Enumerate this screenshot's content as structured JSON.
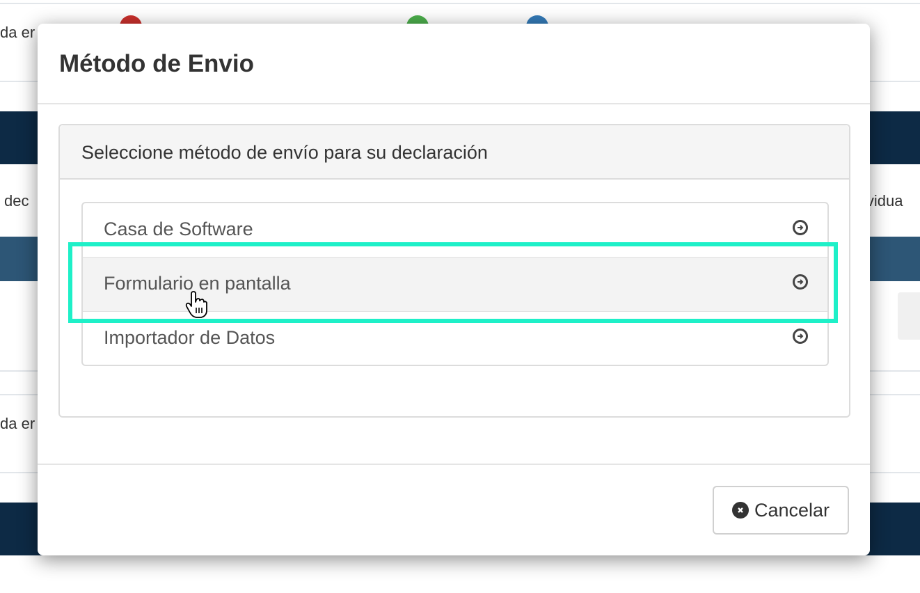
{
  "background": {
    "fragments": {
      "top_left": "da er",
      "mid_left": "dec",
      "mid_right": "ividua",
      "lower_left": "da er"
    },
    "legend_colors": [
      "#c9302c",
      "#4cae4c",
      "#337ab7"
    ],
    "accent_dark": "#0d2a45"
  },
  "modal": {
    "title": "Método de Envio",
    "panel_heading": "Seleccione método de envío para su declaración",
    "items": [
      {
        "label": "Casa de Software",
        "icon": "arrow-circle-right-icon"
      },
      {
        "label": "Formulario en pantalla",
        "icon": "arrow-circle-right-icon"
      },
      {
        "label": "Importador de Datos",
        "icon": "arrow-circle-right-icon"
      }
    ],
    "cancel_label": "Cancelar",
    "cancel_icon": "times-circle-icon"
  },
  "highlight_color": "#1ef0c8"
}
